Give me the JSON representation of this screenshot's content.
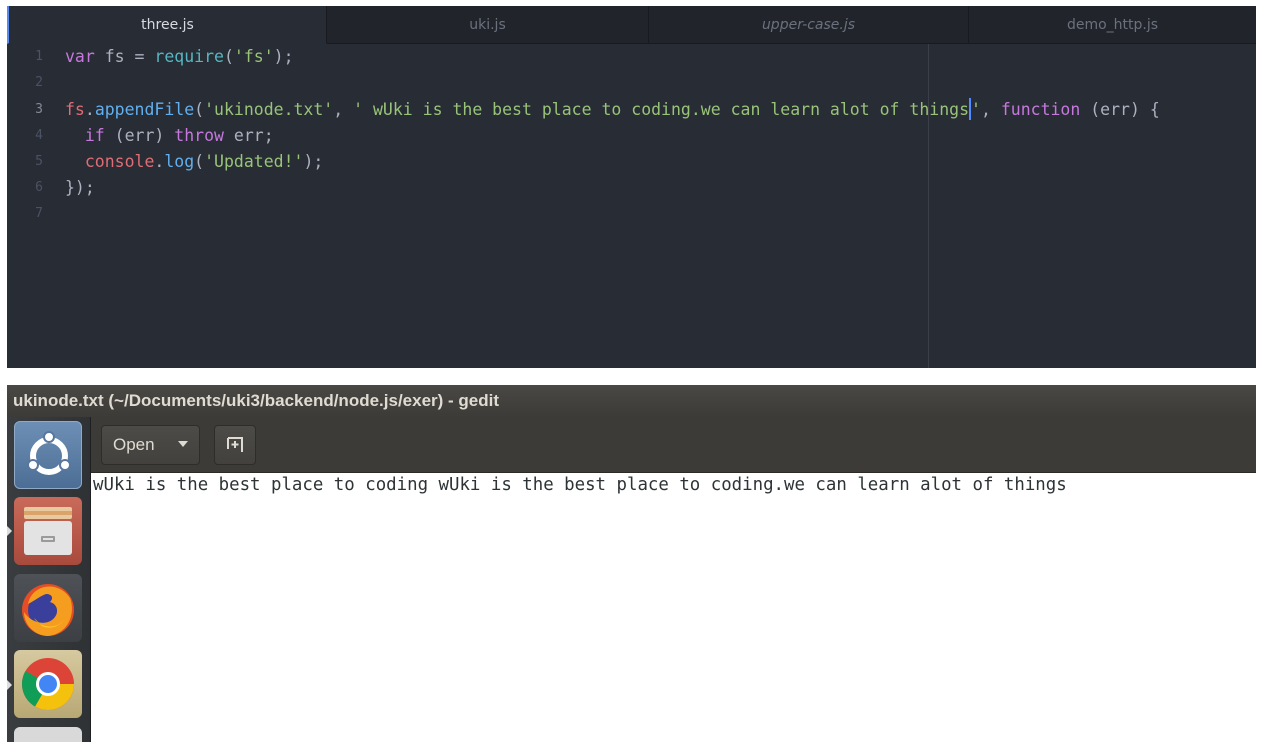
{
  "editor": {
    "tabs": [
      {
        "label": "three.js",
        "active": true,
        "italic": false
      },
      {
        "label": "uki.js",
        "active": false,
        "italic": false
      },
      {
        "label": "upper-case.js",
        "active": false,
        "italic": true
      },
      {
        "label": "demo_http.js",
        "active": false,
        "italic": false
      }
    ],
    "line_numbers": [
      "1",
      "2",
      "3",
      "4",
      "5",
      "6",
      "7"
    ],
    "lines": [
      {
        "tokens": [
          [
            "kw",
            "var"
          ],
          [
            "pl",
            " fs = "
          ],
          [
            "rq",
            "require"
          ],
          [
            "pl",
            "("
          ],
          [
            "st",
            "'fs'"
          ],
          [
            "pl",
            ");"
          ]
        ]
      },
      {
        "tokens": []
      },
      {
        "tokens": [
          [
            "vr",
            "fs"
          ],
          [
            "pl",
            "."
          ],
          [
            "fn",
            "appendFile"
          ],
          [
            "pl",
            "("
          ],
          [
            "st",
            "'ukinode.txt'"
          ],
          [
            "pl",
            ", "
          ],
          [
            "st",
            "' wUki is the best place to coding.we can learn alot of things"
          ],
          [
            "cursor",
            ""
          ],
          [
            "st",
            "'"
          ],
          [
            "pl",
            ", "
          ],
          [
            "kw",
            "function"
          ],
          [
            "pl",
            " (err) {"
          ]
        ]
      },
      {
        "tokens": [
          [
            "pl",
            "  "
          ],
          [
            "kw",
            "if"
          ],
          [
            "pl",
            " (err) "
          ],
          [
            "kw",
            "throw"
          ],
          [
            "pl",
            " err;"
          ]
        ]
      },
      {
        "tokens": [
          [
            "pl",
            "  "
          ],
          [
            "vr",
            "console"
          ],
          [
            "pl",
            "."
          ],
          [
            "fn",
            "log"
          ],
          [
            "pl",
            "("
          ],
          [
            "st",
            "'Updated!'"
          ],
          [
            "pl",
            ");"
          ]
        ]
      },
      {
        "tokens": [
          [
            "pl",
            "});"
          ]
        ]
      },
      {
        "tokens": []
      }
    ],
    "colors": {
      "background": "#282c34",
      "keyword": "#c678dd",
      "function": "#61afef",
      "string": "#98c379",
      "variable": "#e06c75"
    }
  },
  "gedit": {
    "title": "ukinode.txt (~/Documents/uki3/backend/node.js/exer) - gedit",
    "open_label": "Open",
    "dropdown_icon": "chevron-down-icon",
    "new_tab_icon": "new-document-icon",
    "document_text": "wUki is the best place to coding wUki is the best place to coding.we can learn alot of things",
    "launcher_items": [
      {
        "name": "ubuntu-dash-icon",
        "running": false
      },
      {
        "name": "files-icon",
        "running": true
      },
      {
        "name": "firefox-icon",
        "running": false
      },
      {
        "name": "chrome-icon",
        "running": true
      }
    ]
  }
}
